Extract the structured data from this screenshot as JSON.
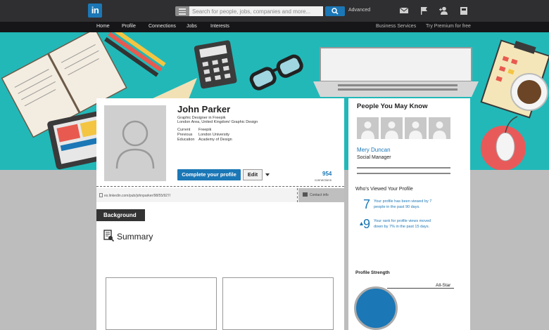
{
  "topbar": {
    "logo_text": "in",
    "search_placeholder": "Search for people, jobs, companies and more...",
    "advanced_label": "Advanced"
  },
  "nav": {
    "items": [
      "Home",
      "Profile",
      "Connections",
      "Jobs",
      "Interests"
    ],
    "business": "Business Services",
    "premium": "Try Premium for free"
  },
  "profile": {
    "name": "John Parker",
    "headline": "Graphic Designer in Freepik",
    "location": "London Area, United Kingdom/ Graphic Design",
    "current_label": "Current",
    "current_value": "Freepik",
    "previous_label": "Previous",
    "previous_value": "London University",
    "education_label": "Education",
    "education_value": "Academy of Design",
    "complete_button": "Complete your profile",
    "edit_button": "Edit",
    "connections_count": "954",
    "connections_label": "connections",
    "url": "es.linkedin.com/pub/johnparker/98/55/927/",
    "contact_info": "Contact info"
  },
  "sections": {
    "background": "Background",
    "summary": "Summary"
  },
  "right": {
    "pymk_title": "People You May Know",
    "person_name": "Mery Duncan",
    "person_title": "Social Manager",
    "viewed_title": "Who's Viewed Your Profile",
    "views_num": "7",
    "views_text_1": "Your profile has been viewed by 7",
    "views_text_2": "people in the past 90 days.",
    "rank_num": "9",
    "rank_text_1": "Your rank for profile views moved",
    "rank_text_2": "down by 7% in the past 15 days.",
    "strength_title": "Profile Strength",
    "strength_level": "All-Star"
  },
  "colors": {
    "brand": "#1b77b6",
    "banner": "#22b8b8",
    "topbar": "#2f2f31"
  }
}
